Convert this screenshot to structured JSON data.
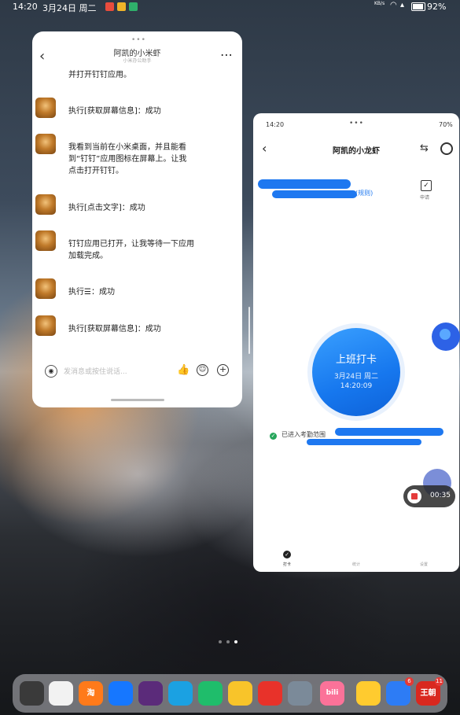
{
  "status_bar": {
    "time": "14:20",
    "date": "3月24日 周二",
    "network": "KB/s",
    "battery": "92%"
  },
  "chat_window": {
    "title": "阿凯的小米虾",
    "subtitle": "小米办公助手",
    "messages": [
      {
        "text": "并打开钉钉应用。",
        "avatar": false
      },
      {
        "text": "执行[获取屏幕信息]：成功",
        "avatar": true
      },
      {
        "text": "我看到当前在小米桌面，并且能看到“钉钉”应用图标在屏幕上。让我点击打开钉钉。",
        "avatar": true
      },
      {
        "text": "执行[点击文字]：成功",
        "avatar": true
      },
      {
        "text": "钉钉应用已打开，让我等待一下应用加载完成。",
        "avatar": true
      },
      {
        "text": "执行☰：成功",
        "avatar": true
      },
      {
        "text": "执行[获取屏幕信息]：成功",
        "avatar": true
      }
    ],
    "input_placeholder": "发消息或按住说话..."
  },
  "app_window": {
    "status_time": "14:20",
    "status_battery": "70%",
    "title": "阿凯的小龙虾",
    "schedule_link": "(规则)",
    "apply_label": "申请",
    "punch_button": {
      "label": "上班打卡",
      "date": "3月24日 周二",
      "time": "14:20:09"
    },
    "geofence_text": "已进入考勤范围",
    "tabs": [
      "打卡",
      "统计",
      "设置"
    ]
  },
  "recording": {
    "time": "00:35"
  },
  "dock": {
    "apps": [
      {
        "name": "phone-app",
        "label": "",
        "color": "#3a3a3a"
      },
      {
        "name": "openai-app",
        "label": "",
        "color": "#f2f2f2"
      },
      {
        "name": "taobao-app",
        "label": "淘",
        "color": "#ff7a1a"
      },
      {
        "name": "dingtalk-app",
        "label": "",
        "color": "#1677ff"
      },
      {
        "name": "photo-app",
        "label": "",
        "color": "#5b2b7a"
      },
      {
        "name": "edge-browser-app",
        "label": "",
        "color": "#1ba1e2"
      },
      {
        "name": "mijia-app",
        "label": "",
        "color": "#1fbd6b"
      },
      {
        "name": "notes-app",
        "label": "",
        "color": "#f8c42a"
      },
      {
        "name": "music-app",
        "label": "",
        "color": "#e8322a"
      },
      {
        "name": "settings-app",
        "label": "",
        "color": "#7b8a99"
      },
      {
        "name": "bilibili-app",
        "label": "bili",
        "color": "#fb7299"
      },
      {
        "name": "files-app",
        "label": "",
        "color": "#ffcb2f"
      },
      {
        "name": "dingtalk-app-2",
        "label": "",
        "color": "#2d7cf5",
        "badge": "6"
      },
      {
        "name": "wangchao-app",
        "label": "王朝",
        "color": "#d9281f",
        "badge": "11"
      }
    ]
  }
}
